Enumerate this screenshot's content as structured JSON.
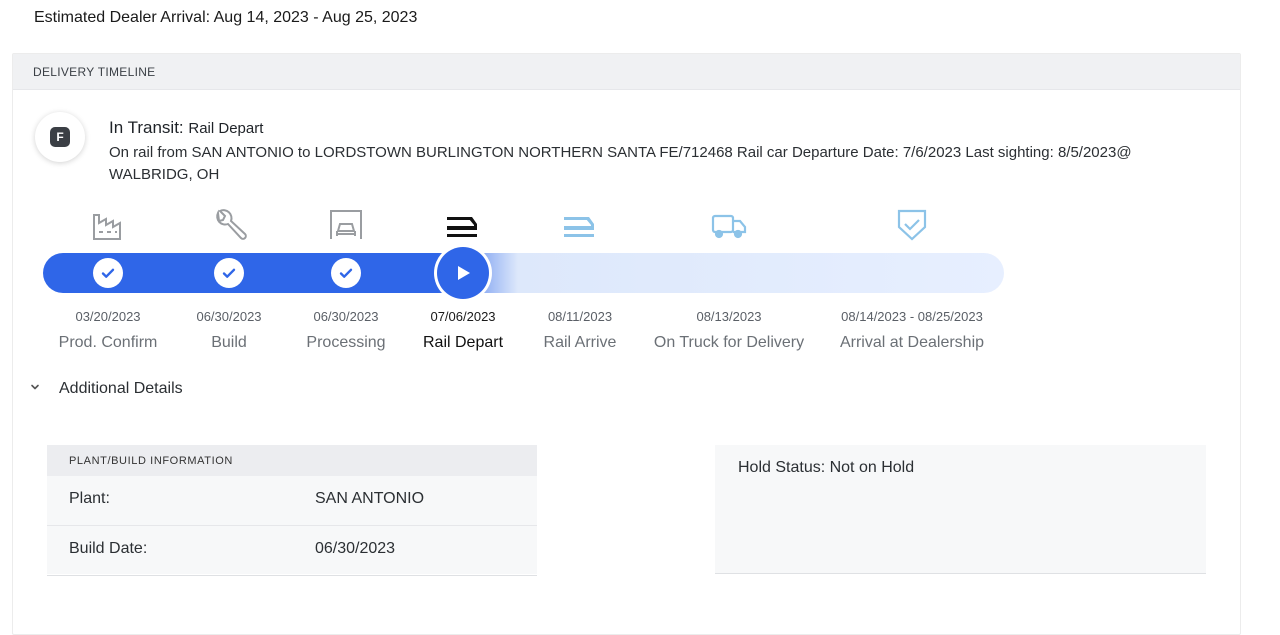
{
  "estimated_arrival": "Estimated Dealer Arrival: Aug 14, 2023 - Aug 25, 2023",
  "timeline": {
    "header": "DELIVERY TIMELINE",
    "badge_letter": "F",
    "status_label": "In Transit:",
    "status_sub": "Rail Depart",
    "status_description": "On rail from SAN ANTONIO to LORDSTOWN BURLINGTON NORTHERN SANTA FE/712468 Rail car Departure Date: 7/6/2023 Last sighting: 8/5/2023@ WALBRIDG, OH",
    "stages": [
      {
        "date": "03/20/2023",
        "label": "Prod. Confirm",
        "state": "complete",
        "icon": "factory-icon"
      },
      {
        "date": "06/30/2023",
        "label": "Build",
        "state": "complete",
        "icon": "wrench-icon"
      },
      {
        "date": "06/30/2023",
        "label": "Processing",
        "state": "complete",
        "icon": "car-garage-icon"
      },
      {
        "date": "07/06/2023",
        "label": "Rail Depart",
        "state": "current",
        "icon": "rail-car-icon"
      },
      {
        "date": "08/11/2023",
        "label": "Rail Arrive",
        "state": "upcoming",
        "icon": "rail-car-icon"
      },
      {
        "date": "08/13/2023",
        "label": "On Truck for Delivery",
        "state": "upcoming",
        "icon": "truck-icon"
      },
      {
        "date": "08/14/2023 - 08/25/2023",
        "label": "Arrival at Dealership",
        "state": "upcoming",
        "icon": "shield-check-icon"
      }
    ]
  },
  "additional_details": {
    "label": "Additional Details",
    "plant_card": {
      "header": "PLANT/BUILD INFORMATION",
      "rows": [
        {
          "key": "Plant:",
          "value": "SAN ANTONIO"
        },
        {
          "key": "Build Date:",
          "value": "06/30/2023"
        }
      ]
    },
    "hold_status": "Hold Status: Not on Hold"
  },
  "colors": {
    "accent": "#2f66e8",
    "track_upcoming": "#e7efff",
    "icon_complete": "#9a9da1",
    "icon_upcoming": "#8cc3e8"
  }
}
